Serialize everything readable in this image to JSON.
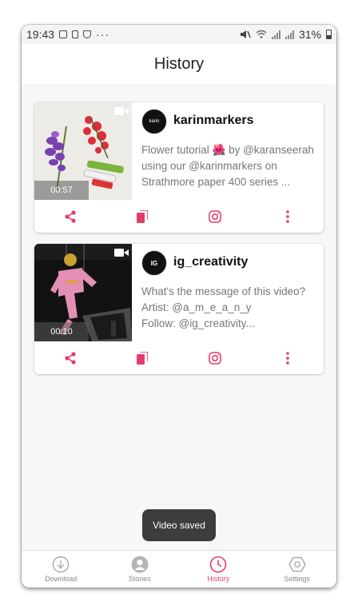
{
  "status_bar": {
    "time": "19:43",
    "more": "···",
    "battery": "31%"
  },
  "header": {
    "title": "History"
  },
  "cards": [
    {
      "username": "karinmarkers",
      "avatar_text": "karin",
      "caption": "Flower tutorial 🌺 by @karanseerah using our @karinmarkers on Strathmore paper 400 series ...",
      "duration": "00:57"
    },
    {
      "username": "ig_creativity",
      "avatar_text": "IG",
      "caption": "What's the message of this video?\nArtist: @a_m_e_a_n_y\nFollow: @ig_creativity...",
      "duration": "00:10"
    }
  ],
  "toast": {
    "text": "Video saved"
  },
  "bottom_nav": {
    "items": [
      {
        "label": "Download",
        "icon": "download-icon"
      },
      {
        "label": "Stories",
        "icon": "profile-icon"
      },
      {
        "label": "History",
        "icon": "clock-icon",
        "active": true
      },
      {
        "label": "Settings",
        "icon": "hexagon-settings-icon"
      }
    ]
  },
  "colors": {
    "accent": "#e33d6b",
    "inactive": "#888888",
    "toast_bg": "#3d3d3d"
  }
}
